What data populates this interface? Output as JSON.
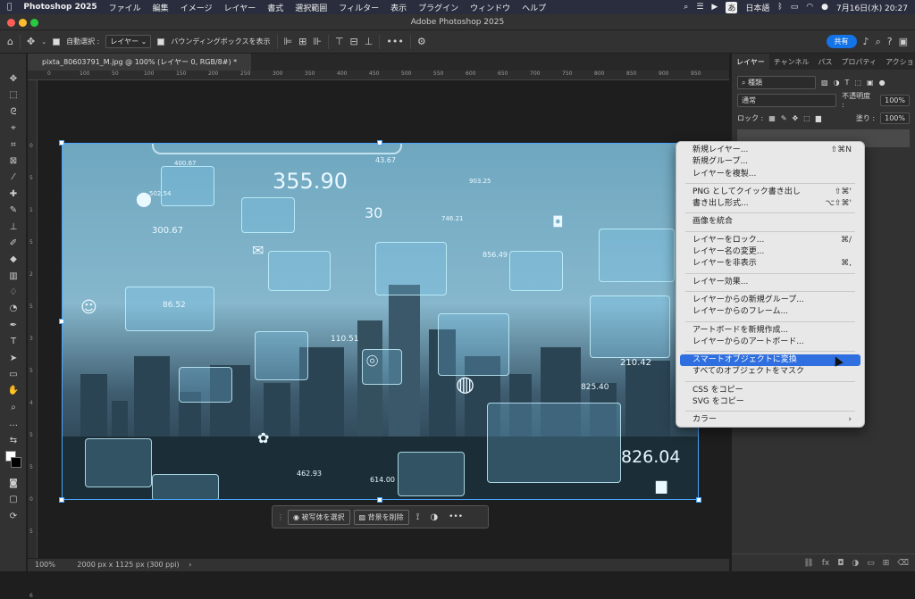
{
  "menubar": {
    "app": "Photoshop 2025",
    "items": [
      "ファイル",
      "編集",
      "イメージ",
      "レイヤー",
      "書式",
      "選択範囲",
      "フィルター",
      "表示",
      "プラグイン",
      "ウィンドウ",
      "ヘルプ"
    ],
    "input_label": "あ",
    "input_mode": "日本語",
    "clock": "7月16日(水) 20:27"
  },
  "window": {
    "title": "Adobe Photoshop 2025"
  },
  "options": {
    "auto_select_label": "自動選択 :",
    "auto_select_value": "レイヤー",
    "bbox_label": "バウンディングボックスを表示",
    "more": "•••",
    "share_label": "共有"
  },
  "document": {
    "tab_title": "pixta_80603791_M.jpg @ 100% (レイヤー 0, RGB/8#) *",
    "zoom": "100%",
    "doc_info": "2000 px x 1125 px (300 ppi)"
  },
  "ruler": {
    "h_ticks": [
      "0",
      "100",
      "50",
      "100",
      "150",
      "200",
      "250",
      "300",
      "350",
      "400",
      "450",
      "500",
      "550",
      "600",
      "650",
      "700",
      "750",
      "800",
      "850",
      "900",
      "950"
    ],
    "v_ticks": [
      "0",
      "5",
      "1",
      "5",
      "2",
      "5",
      "3",
      "5",
      "4",
      "5",
      "5",
      "0",
      "5",
      "5",
      "6"
    ]
  },
  "canvas_numbers": [
    "355.90",
    "400.67",
    "43.67",
    "903.25",
    "502.54",
    "300.67",
    "30",
    "746.21",
    "856.49",
    "210.42",
    "825.40",
    "826.04",
    "614.00",
    "462.93",
    "110.51",
    "86.52"
  ],
  "taskbar": {
    "select_subject": "被写体を選択",
    "remove_bg": "背景を削除",
    "more": "•••"
  },
  "panel": {
    "tabs": [
      "レイヤー",
      "チャンネル",
      "パス",
      "プロパティ",
      "アクション"
    ],
    "filter_value": "種類",
    "blend_mode": "通常",
    "opacity_label": "不透明度 :",
    "opacity_value": "100%",
    "lock_label": "ロック :",
    "fill_label": "塗り :",
    "fill_value": "100%"
  },
  "context_menu": {
    "groups": [
      [
        {
          "label": "新規レイヤー...",
          "shortcut": "⇧⌘N"
        },
        {
          "label": "新規グループ...",
          "shortcut": ""
        },
        {
          "label": "レイヤーを複製...",
          "shortcut": ""
        }
      ],
      [
        {
          "label": "PNG としてクイック書き出し",
          "shortcut": "⇧⌘'"
        },
        {
          "label": "書き出し形式...",
          "shortcut": "⌥⇧⌘'"
        }
      ],
      [
        {
          "label": "画像を統合",
          "shortcut": ""
        }
      ],
      [
        {
          "label": "レイヤーをロック...",
          "shortcut": "⌘/"
        },
        {
          "label": "レイヤー名の変更...",
          "shortcut": ""
        },
        {
          "label": "レイヤーを非表示",
          "shortcut": "⌘,"
        }
      ],
      [
        {
          "label": "レイヤー効果...",
          "shortcut": ""
        }
      ],
      [
        {
          "label": "レイヤーからの新規グループ...",
          "shortcut": ""
        },
        {
          "label": "レイヤーからのフレーム...",
          "shortcut": ""
        }
      ],
      [
        {
          "label": "アートボードを新規作成...",
          "shortcut": ""
        },
        {
          "label": "レイヤーからのアートボード...",
          "shortcut": ""
        }
      ],
      [
        {
          "label": "スマートオブジェクトに変換",
          "shortcut": "",
          "highlighted": true
        },
        {
          "label": "すべてのオブジェクトをマスク",
          "shortcut": ""
        }
      ],
      [
        {
          "label": "CSS をコピー",
          "shortcut": ""
        },
        {
          "label": "SVG をコピー",
          "shortcut": ""
        }
      ],
      [
        {
          "label": "カラー",
          "shortcut": "›"
        }
      ]
    ]
  },
  "colors": {
    "accent": "#1473e6",
    "highlight": "#2f6fe0",
    "canvas_frame": "#4aa6ff"
  }
}
